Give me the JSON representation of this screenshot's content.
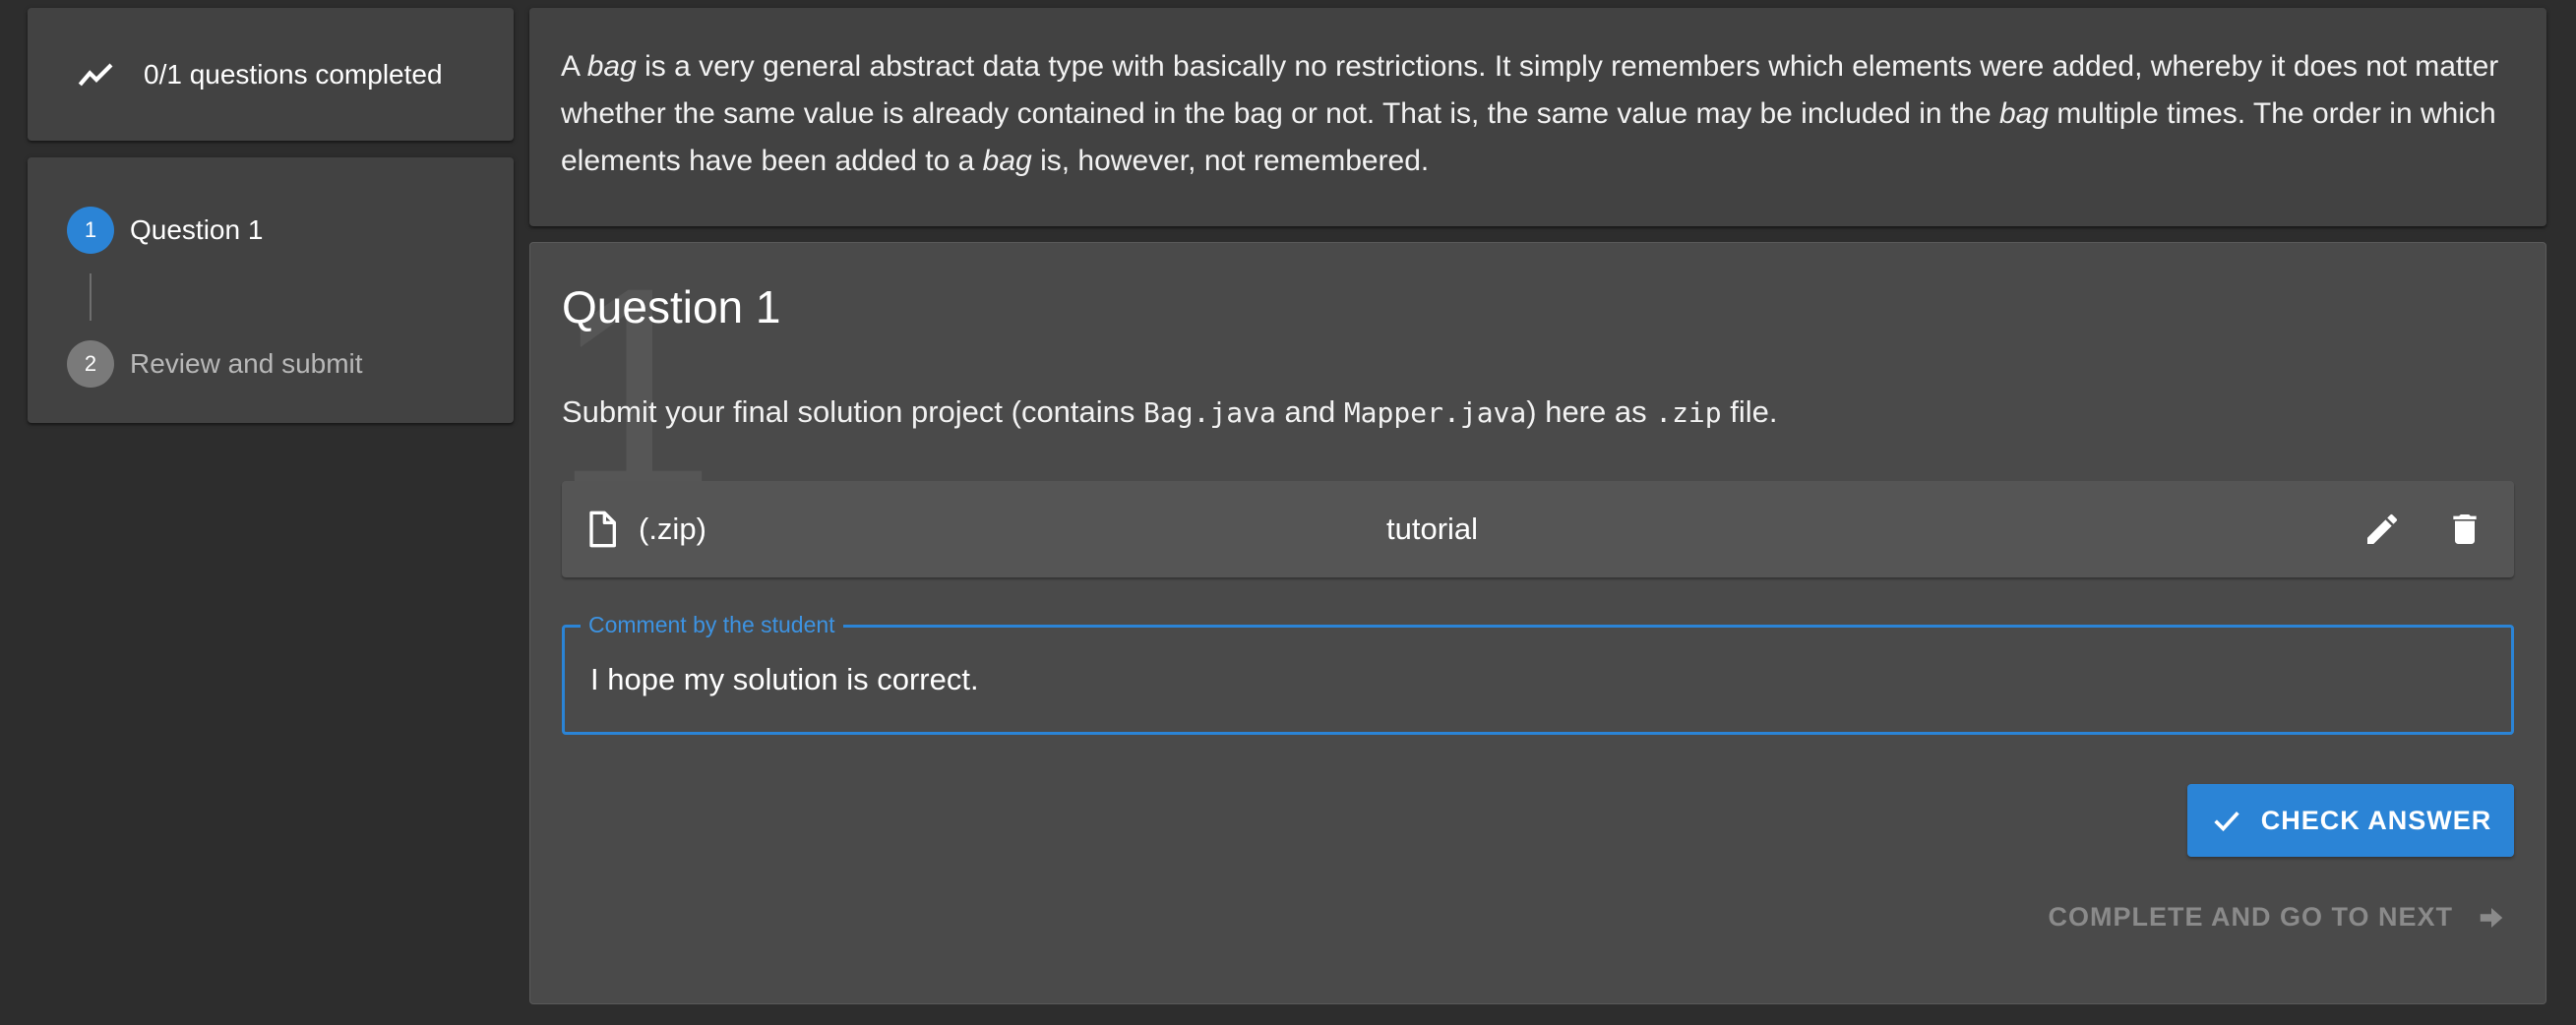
{
  "sidebar": {
    "progress_label": "0/1 questions completed",
    "steps": [
      {
        "number": "1",
        "label": "Question 1",
        "state": "active"
      },
      {
        "number": "2",
        "label": "Review and submit",
        "state": "inactive"
      }
    ]
  },
  "intro": {
    "parts": [
      "A ",
      "bag",
      " is a very general abstract data type with basically no restrictions. It simply remembers which elements were added, whereby it does not matter whether the same value is already contained in the bag or not. That is, the same value may be included in the ",
      "bag",
      " multiple times. The order in which elements have been added to a ",
      "bag",
      " is, however, not remembered."
    ]
  },
  "question": {
    "number_watermark": "1",
    "title": "Question 1",
    "text_before": "Submit your final solution project (contains ",
    "code1": "Bag.java",
    "text_mid1": " and ",
    "code2": "Mapper.java",
    "text_mid2": ") here as ",
    "code3": ".zip",
    "text_after": " file.",
    "file": {
      "extension": "(.zip)",
      "name": "tutorial",
      "icon": "file-icon",
      "actions": [
        "edit-icon",
        "delete-icon"
      ]
    },
    "comment": {
      "label": "Comment by the student",
      "value": "I hope my solution is correct."
    },
    "check_button": "CHECK ANSWER",
    "next_button": "COMPLETE AND GO TO NEXT"
  },
  "colors": {
    "accent": "#2b84d6",
    "background": "#2d2d2d",
    "card": "#424242"
  }
}
